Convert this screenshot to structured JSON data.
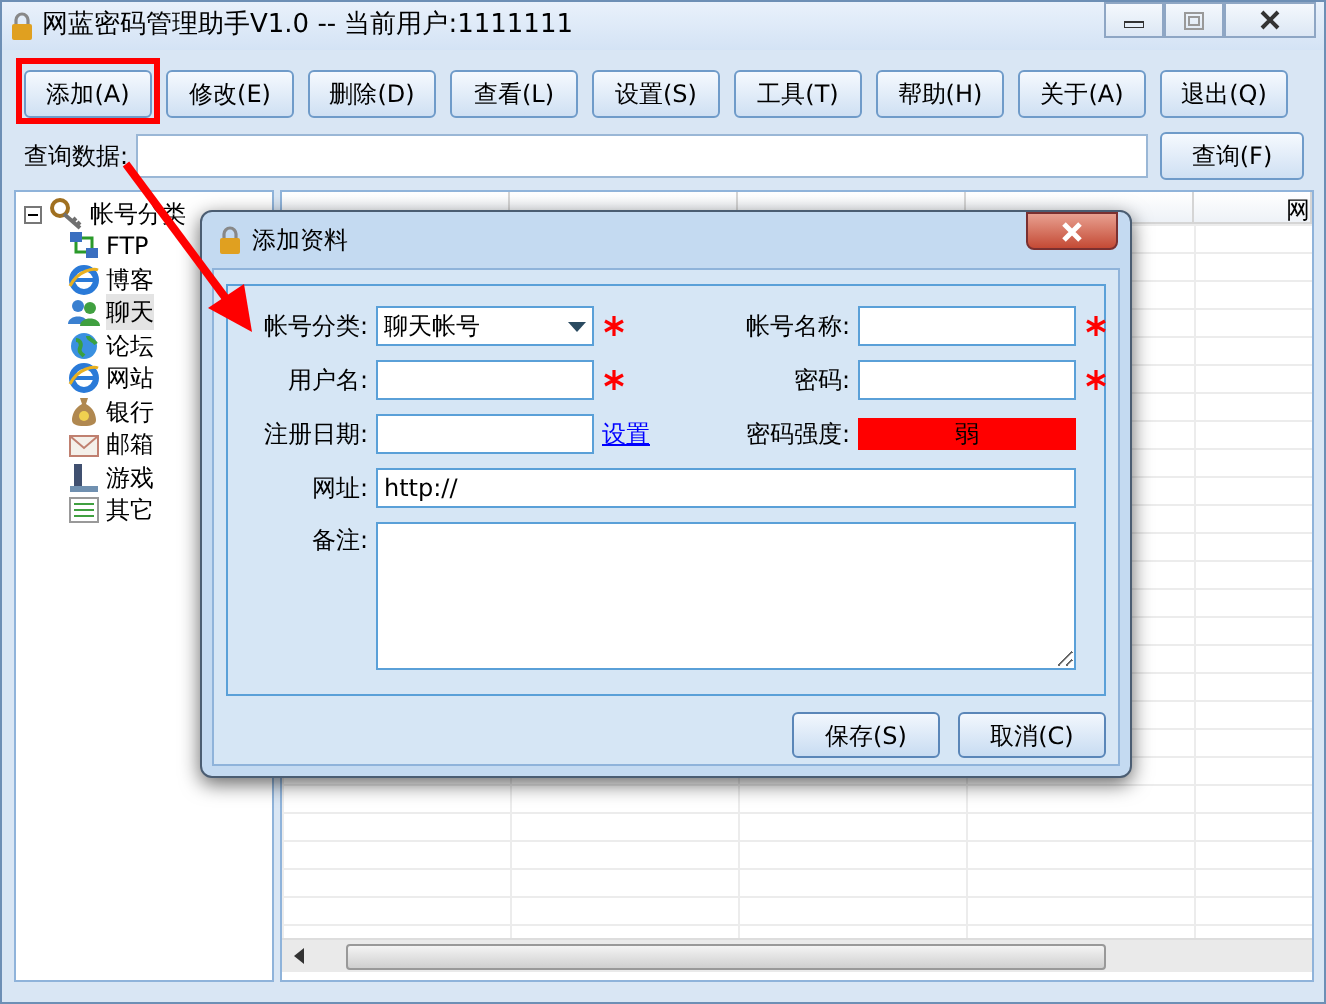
{
  "window": {
    "title": "网蓝密码管理助手V1.0 -- 当前用户:1111111"
  },
  "toolbar": [
    "添加(A)",
    "修改(E)",
    "删除(D)",
    "查看(L)",
    "设置(S)",
    "工具(T)",
    "帮助(H)",
    "关于(A)",
    "退出(Q)"
  ],
  "search": {
    "label": "查询数据:",
    "button": "查询(F)"
  },
  "tree": {
    "label": "帐号分类",
    "expanded": true,
    "children": [
      {
        "label": "FTP",
        "selected": false
      },
      {
        "label": "博客",
        "selected": false
      },
      {
        "label": "聊天",
        "selected": true
      },
      {
        "label": "论坛",
        "selected": false
      },
      {
        "label": "网站",
        "selected": false
      },
      {
        "label": "银行",
        "selected": false
      },
      {
        "label": "邮箱",
        "selected": false
      },
      {
        "label": "游戏",
        "selected": false
      },
      {
        "label": "其它",
        "selected": false
      }
    ]
  },
  "table": {
    "column_5": "网"
  },
  "dialog": {
    "title": "添加资料",
    "category": {
      "label": "帐号分类:",
      "value": "聊天帐号",
      "required": true
    },
    "account_name": {
      "label": "帐号名称:",
      "required": true
    },
    "username": {
      "label": "用户名:",
      "required": true
    },
    "password": {
      "label": "密码:",
      "required": true
    },
    "register_date": {
      "label": "注册日期:",
      "link": "设置"
    },
    "password_strength": {
      "label": "密码强度:",
      "value": "弱"
    },
    "url": {
      "label": "网址:",
      "value": "http://"
    },
    "notes": {
      "label": "备注:"
    },
    "buttons": [
      "保存(S)",
      "取消(C)"
    ]
  }
}
